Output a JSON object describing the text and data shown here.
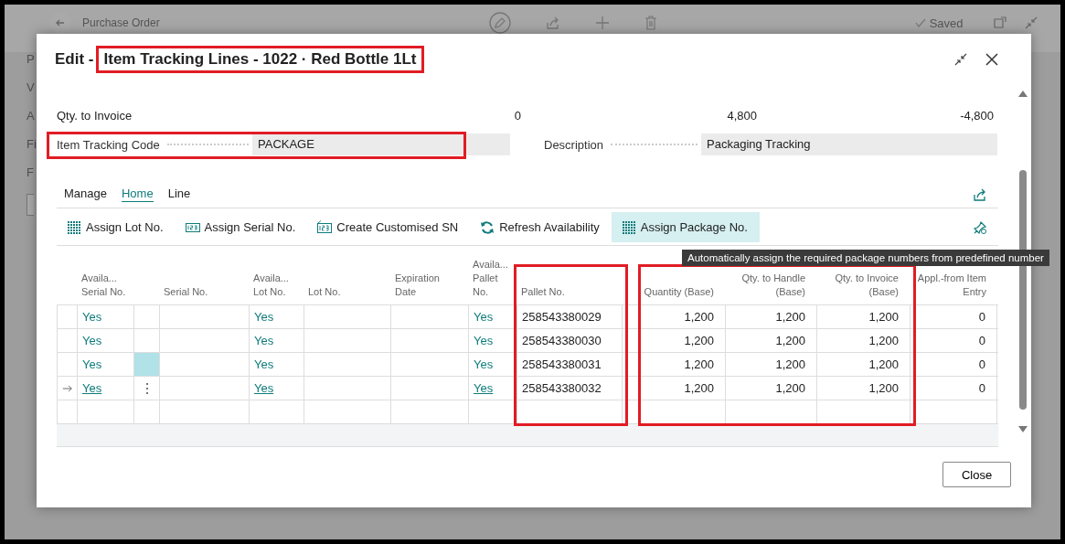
{
  "background_page": {
    "title": "Purchase Order",
    "status": "Saved",
    "side_fragments": [
      "P",
      "V",
      "A",
      "Fi",
      "F"
    ]
  },
  "dialog": {
    "title_prefix": "Edit -",
    "title": "Item Tracking Lines - 1022 · Red Bottle 1Lt",
    "title_highlighted": true
  },
  "totals_row": {
    "label": "Qty. to Invoice",
    "values": [
      "0",
      "4,800",
      "-4,800"
    ]
  },
  "fields": [
    {
      "label": "Item Tracking Code",
      "value": "PACKAGE",
      "highlighted": true
    },
    {
      "label": "Description",
      "value": "Packaging Tracking"
    }
  ],
  "action_tabs": [
    {
      "label": "Manage",
      "selected": false
    },
    {
      "label": "Home",
      "selected": true
    },
    {
      "label": "Line",
      "selected": false
    }
  ],
  "actions": [
    {
      "label": "Assign Lot No.",
      "hovered": false
    },
    {
      "label": "Assign Serial No.",
      "hovered": false
    },
    {
      "label": "Create Customised SN",
      "hovered": false
    },
    {
      "label": "Refresh Availability",
      "hovered": false
    },
    {
      "label": "Assign Package No.",
      "hovered": true
    }
  ],
  "tooltip": "Automatically assign the required package numbers from predefined number",
  "table": {
    "columns": [
      {
        "kind": "marker"
      },
      {
        "kind": "link",
        "label": "Availa... Serial No."
      },
      {
        "kind": "menu"
      },
      {
        "kind": "text",
        "label": "Serial No."
      },
      {
        "kind": "link",
        "label": "Availa... Lot No."
      },
      {
        "kind": "text",
        "label": "Lot No."
      },
      {
        "kind": "text",
        "label": "Expiration Date"
      },
      {
        "kind": "link",
        "label": "Availa... Pallet No."
      },
      {
        "kind": "text",
        "label": "Pallet No.",
        "highlighted": true
      },
      {
        "kind": "number",
        "label": "Quantity (Base)",
        "highlighted": true,
        "highlight_starts": true
      },
      {
        "kind": "number",
        "label": "Qty. to Handle (Base)",
        "highlighted": true
      },
      {
        "kind": "number",
        "label": "Qty. to Invoice (Base)",
        "highlighted": true
      },
      {
        "kind": "number",
        "label": "Appl.-from Item Entry"
      }
    ],
    "rows": [
      {
        "selected": false,
        "current": false,
        "avail_serial": "Yes",
        "avail_lot": "Yes",
        "avail_pallet": "Yes",
        "pallet_no": "258543380029",
        "quantity_base": "1,200",
        "qty_to_handle_base": "1,200",
        "qty_to_invoice_base": "1,200",
        "appl_from_item_entry": "0"
      },
      {
        "selected": false,
        "current": false,
        "avail_serial": "Yes",
        "avail_lot": "Yes",
        "avail_pallet": "Yes",
        "pallet_no": "258543380030",
        "quantity_base": "1,200",
        "qty_to_handle_base": "1,200",
        "qty_to_invoice_base": "1,200",
        "appl_from_item_entry": "0"
      },
      {
        "selected": true,
        "current": false,
        "avail_serial": "Yes",
        "avail_lot": "Yes",
        "avail_pallet": "Yes",
        "pallet_no": "258543380031",
        "quantity_base": "1,200",
        "qty_to_handle_base": "1,200",
        "qty_to_invoice_base": "1,200",
        "appl_from_item_entry": "0"
      },
      {
        "selected": false,
        "current": true,
        "avail_serial": "Yes",
        "avail_lot": "Yes",
        "avail_pallet": "Yes",
        "pallet_no": "258543380032",
        "quantity_base": "1,200",
        "qty_to_handle_base": "1,200",
        "qty_to_invoice_base": "1,200",
        "appl_from_item_entry": "0"
      },
      {
        "selected": false,
        "current": false
      }
    ]
  },
  "footer_buttons": [
    "Close"
  ]
}
